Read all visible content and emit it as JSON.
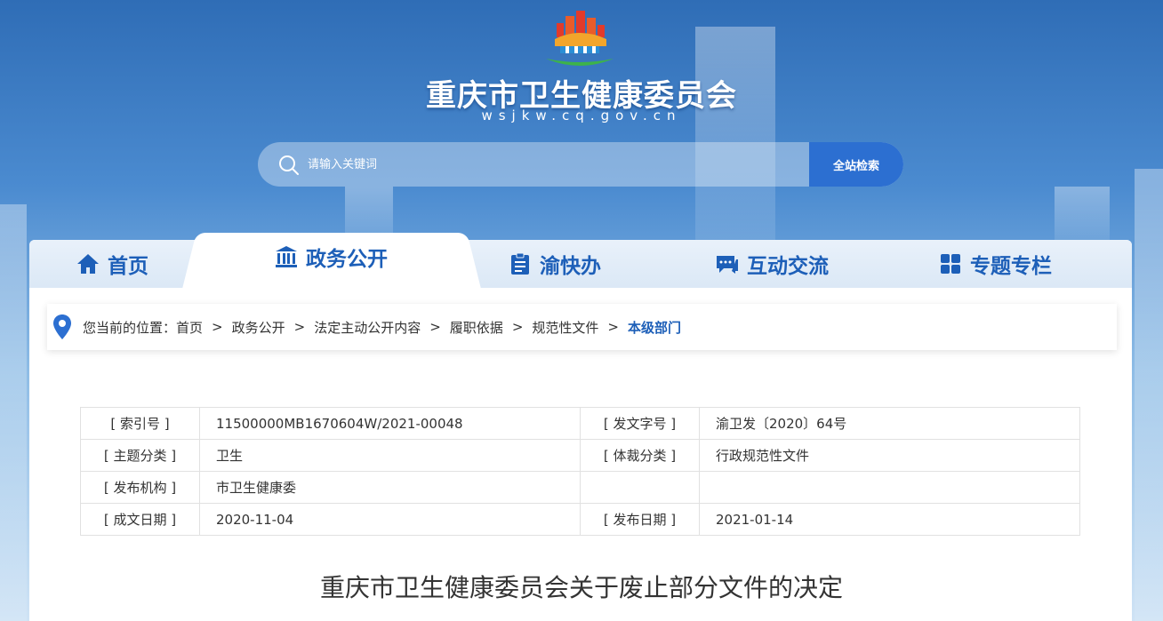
{
  "header": {
    "site_title": "重庆市卫生健康委员会",
    "site_domain": "wsjkw.cq.gov.cn"
  },
  "search": {
    "placeholder": "请输入关键词",
    "button_label": "全站检索"
  },
  "nav": {
    "items": [
      {
        "label": "首页",
        "icon": "home-icon"
      },
      {
        "label": "政务公开",
        "icon": "bank-icon",
        "active": true
      },
      {
        "label": "渝快办",
        "icon": "clipboard-icon"
      },
      {
        "label": "互动交流",
        "icon": "chat-icon"
      },
      {
        "label": "专题专栏",
        "icon": "grid-icon"
      }
    ]
  },
  "breadcrumb": {
    "prefix": "您当前的位置：",
    "items": [
      "首页",
      "政务公开",
      "法定主动公开内容",
      "履职依据",
      "规范性文件",
      "本级部门"
    ],
    "separator": ">"
  },
  "meta": {
    "rows": [
      {
        "l1": "[ 索引号 ]",
        "v1": "11500000MB1670604W/2021-00048",
        "l2": "[ 发文字号 ]",
        "v2": "渝卫发〔2020〕64号"
      },
      {
        "l1": "[ 主题分类 ]",
        "v1": "卫生",
        "l2": "[ 体裁分类 ]",
        "v2": "行政规范性文件"
      },
      {
        "l1": "[ 发布机构 ]",
        "v1": "市卫生健康委",
        "l2": "",
        "v2": ""
      },
      {
        "l1": "[ 成文日期 ]",
        "v1": "2020-11-04",
        "l2": "[ 发布日期 ]",
        "v2": "2021-01-14"
      }
    ]
  },
  "document": {
    "title": "重庆市卫生健康委员会关于废止部分文件的决定"
  },
  "colors": {
    "accent": "#1d5fb8",
    "button": "#2c6fd1"
  }
}
